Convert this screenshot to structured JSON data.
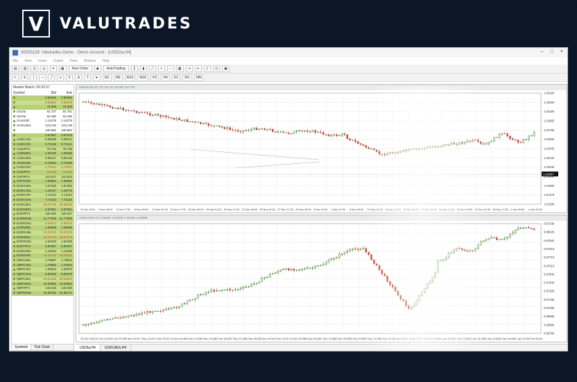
{
  "brand": {
    "logo_letter": "V",
    "name": "VALUTRADES"
  },
  "window": {
    "title": "30025128: Valutrades-Demo - Demo Account - [USDOa,H4]",
    "controls": [
      "–",
      "□",
      "×"
    ]
  },
  "menu": [
    "File",
    "View",
    "Insert",
    "Charts",
    "Tools",
    "Window",
    "Help"
  ],
  "toolbar": {
    "new_order": "New Order",
    "auto_trading": "AutoTrading",
    "timeframes": [
      "M1",
      "M5",
      "M15",
      "M30",
      "H1",
      "H4",
      "D1",
      "W1",
      "MN"
    ]
  },
  "market_watch": {
    "title": "Market Watch: 06:32:57",
    "columns": {
      "symbol": "Symbol",
      "bid": "Bid",
      "ask": "Ask"
    },
    "rows": [
      {
        "s": "",
        "b": "0.89466",
        "a": "0.89456",
        "style": "odd",
        "red": false
      },
      {
        "s": "",
        "b": "0.88869",
        "a": "0.88879",
        "style": "even",
        "red": true
      },
      {
        "s": "",
        "b": "75.809",
        "a": "75.819",
        "style": "odd",
        "red": false
      },
      {
        "s": "USOIa",
        "b": "54.737",
        "a": "54.751",
        "style": "white",
        "red": false
      },
      {
        "s": "UKOIa",
        "b": "62.450",
        "a": "62.466",
        "style": "white",
        "red": false
      },
      {
        "s": "XAUUSD",
        "b": "1.14278",
        "a": "1.14279",
        "style": "white",
        "red": false
      },
      {
        "s": "XAGUSDx",
        "b": "1314.05",
        "a": "1314.39",
        "style": "white",
        "red": false
      },
      {
        "s": "",
        "b": "109.866",
        "a": "109.892",
        "style": "white",
        "red": false
      },
      {
        "s": "",
        "b": "0.97567",
        "a": "0.97576",
        "style": "odd",
        "red": false
      },
      {
        "s": "AUDCADx",
        "b": "0.95258",
        "a": "0.95312",
        "style": "even",
        "red": false
      },
      {
        "s": "AUDCHFx",
        "b": "0.72135",
        "a": "0.72141",
        "style": "odd",
        "red": false
      },
      {
        "s": "AUDJPYx",
        "b": "78.703",
        "a": "78.729",
        "style": "even",
        "red": false
      },
      {
        "s": "AUDNZDx",
        "b": "1.05235",
        "a": "1.05256",
        "style": "odd",
        "red": false
      },
      {
        "s": "AUDUSDx",
        "b": "0.80127",
        "a": "0.80135",
        "style": "even",
        "red": false
      },
      {
        "s": "AVAXUSD",
        "b": "0.72623",
        "a": "0.72629",
        "style": "odd",
        "red": false
      },
      {
        "s": "CADCHFx",
        "b": "0.75312",
        "a": "0.75321",
        "style": "even",
        "red": true
      },
      {
        "s": "CADJPYx",
        "b": "83.535",
        "a": "83.549",
        "style": "odd",
        "red": true
      },
      {
        "s": "CHFJPYx",
        "b": "110.517",
        "a": "110.523",
        "style": "even",
        "red": false
      },
      {
        "s": "CHFSGDx",
        "b": "1.35064",
        "a": "1.35082",
        "style": "odd",
        "red": false
      },
      {
        "s": "EURAUDx",
        "b": "1.57330",
        "a": "1.57352",
        "style": "even",
        "red": false
      },
      {
        "s": "EURCADx",
        "b": "1.49767",
        "a": "1.49776",
        "style": "odd",
        "red": false
      },
      {
        "s": "EURCHFx",
        "b": "1.14112",
        "a": "1.14114",
        "style": "even",
        "red": false
      },
      {
        "s": "EURCNHx",
        "b": "7.73143",
        "a": "7.73148",
        "style": "odd",
        "red": false
      },
      {
        "s": "EURCZKx",
        "b": "25.67759",
        "a": "25.69269",
        "style": "even",
        "red": true
      },
      {
        "s": "EURGBPx",
        "b": "0.87551",
        "a": "0.87561",
        "style": "odd",
        "red": false
      },
      {
        "s": "EURJPYx",
        "b": "125.545",
        "a": "125.547",
        "style": "even",
        "red": false
      },
      {
        "s": "EURMXNx",
        "b": "21.77249",
        "a": "21.77509",
        "style": "odd",
        "red": false
      },
      {
        "s": "EURNOKx",
        "b": "9.68573",
        "a": "9.69073",
        "style": "even",
        "red": true
      },
      {
        "s": "EURNZDx",
        "b": "1.65568",
        "a": "1.65598",
        "style": "odd",
        "red": false
      },
      {
        "s": "EURRUBx",
        "b": "75.03370",
        "a": "75.07578",
        "style": "even",
        "red": true
      },
      {
        "s": "EURSEKx",
        "b": "10.31373",
        "a": "10.31774",
        "style": "odd",
        "red": true
      },
      {
        "s": "EURSGDx",
        "b": "1.54433",
        "a": "1.54439",
        "style": "even",
        "red": false
      },
      {
        "s": "EURTRYx",
        "b": "5.90387",
        "a": "5.90497",
        "style": "odd",
        "red": false
      },
      {
        "s": "EURUSDx",
        "b": "1.14264",
        "a": "1.14265",
        "style": "even",
        "red": false
      },
      {
        "s": "EURZARx",
        "b": "15.26162",
        "a": "15.28332",
        "style": "odd",
        "red": true
      },
      {
        "s": "GBPAUDx",
        "b": "1.79687",
        "a": "1.79812",
        "style": "even",
        "red": false
      },
      {
        "s": "GBPCADx",
        "b": "1.70893",
        "a": "1.70918",
        "style": "odd",
        "red": false
      },
      {
        "s": "GBPCHFx",
        "b": "1.30344",
        "a": "1.30370",
        "style": "even",
        "red": false
      },
      {
        "s": "GBPCNHx",
        "b": "8.82329",
        "a": "8.83079",
        "style": "odd",
        "red": false
      },
      {
        "s": "GBPCZKx",
        "b": "29.31408",
        "a": "29.35564",
        "style": "even",
        "red": true
      },
      {
        "s": "GBPHKDx",
        "b": "10.20382",
        "a": "10.20562",
        "style": "odd",
        "red": false
      },
      {
        "s": "GBPJPYx",
        "b": "143.318",
        "a": "143.330",
        "style": "even",
        "red": false
      },
      {
        "s": "GBPMXNx",
        "b": "24.85432",
        "a": "24.85714",
        "style": "odd",
        "red": false
      }
    ],
    "tabs": [
      "Symbols",
      "Tick Chart"
    ]
  },
  "charts": [
    {
      "title": "USOIa,H4  54.737 54.747 54.667 54.737",
      "y_ticks": [
        "1.03180",
        "1.03250",
        "1.03160",
        "1.02965",
        "1.02780",
        "1.02590",
        "1.02405",
        "1.02220",
        "1.02030",
        "1.01845",
        "1.01660",
        "1.01475",
        "1.01295"
      ],
      "price_tag": "1.01607",
      "x_ticks": [
        "29 Oct 2018",
        "2 Nov 05:00",
        "5 Nov 17:00",
        "8 Nov 09:00",
        "12 Nov 01:00",
        "13 Nov 17:00",
        "15 Nov 09:00",
        "19 Nov 01:00",
        "20 Nov 17:00",
        "22 Nov 09:00",
        "26 Nov 01:00",
        "27 Nov 17:00",
        "29 Nov 09:00",
        "3 Dec 01:00",
        "4 Dec 17:00",
        "6 Dec 09:00",
        "10 Dec 01:00",
        "11 Dec 17:00",
        "13 Dec 09:00",
        "17 Dec 01:00",
        "18 Dec 17:00",
        "20 Dec 09:00",
        "24 Dec 01:00",
        "26 Dec 17:00",
        "2 Jan 09:00",
        "4 Jan 01:00"
      ]
    },
    {
      "title": "USDCADx,H4  1.32582 1.32539 1.32434 1.32698",
      "y_ticks": [
        "0.97330",
        "0.98025",
        "0.97920",
        "0.97815",
        "0.97710",
        "0.97610",
        "0.97505",
        "0.97400",
        "0.97295",
        "0.97195",
        "0.97090",
        "0.96985",
        "0.96880",
        "0.96780"
      ],
      "x_ticks": [
        "26 Oct 2018",
        "29 Oct 12:00",
        "31 Oct 20:00",
        "5 Nov 04:00",
        "7 Nov 12:00",
        "9 Nov 20:00",
        "14 Nov 04:00",
        "16 Nov 12:00",
        "20 Nov 20:00",
        "23 Nov 04:00",
        "27 Nov 12:00",
        "29 Nov 20:00",
        "4 Dec 04:00",
        "6 Dec 12:00",
        "10 Dec 20:00",
        "13 Dec 04:00",
        "17 Dec 12:00",
        "19 Dec 20:00",
        "24 Dec 04:00",
        "27 Dec 12:00",
        "31 Dec 20:00",
        "4 Jan 04:00",
        "8 Jan 12:00",
        "10 Jan 20:00",
        "15 Jan 04:00",
        "17 Jan 12:00",
        "22 Jan 04:00",
        "24 Jan 12:00",
        "29 Jan 04:00",
        "31 Jan 12:00",
        "4 Feb 00:00"
      ]
    }
  ],
  "chart_tabs": [
    "USOIa,H4",
    "USDCADx,H4"
  ],
  "colors": {
    "bull": "#3a7d22",
    "bear": "#c24a3a",
    "row_green": "#b9d27a",
    "bg": "#0b1626"
  }
}
